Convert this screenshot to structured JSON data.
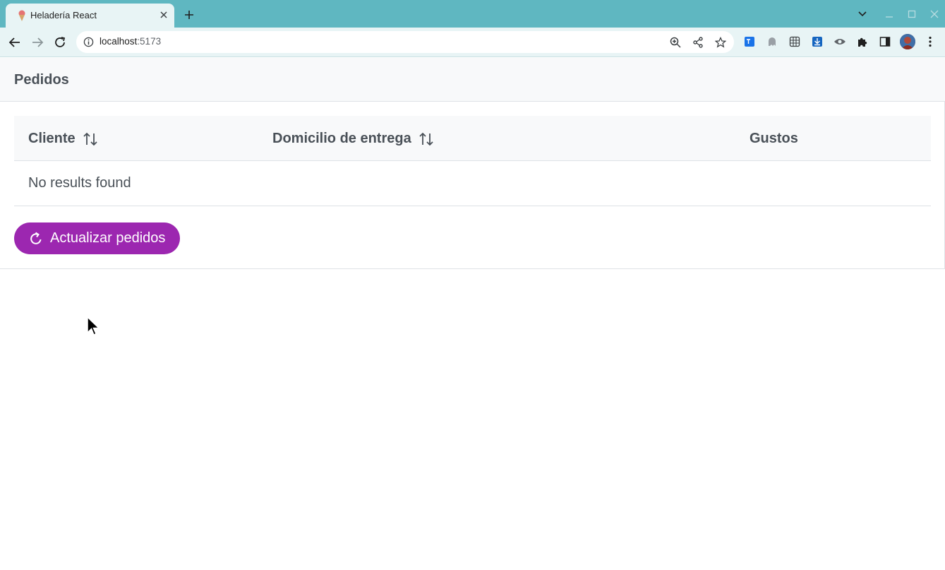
{
  "browser": {
    "tab": {
      "title": "Heladería React",
      "favicon": "ice-cream-icon"
    },
    "address": {
      "host": "localhost",
      "port": ":5173"
    },
    "colors": {
      "tabstrip": "#5fb7c1",
      "toolbar": "#e8f4f5"
    }
  },
  "page": {
    "title": "Pedidos",
    "table": {
      "columns": [
        {
          "label": "Cliente",
          "sortable": true
        },
        {
          "label": "Domicilio de entrega",
          "sortable": true
        },
        {
          "label": "Gustos",
          "sortable": false
        }
      ],
      "empty_message": "No results found"
    },
    "refresh_button": {
      "label": "Actualizar pedidos",
      "icon": "refresh-icon",
      "color": "#9c27b0"
    }
  }
}
